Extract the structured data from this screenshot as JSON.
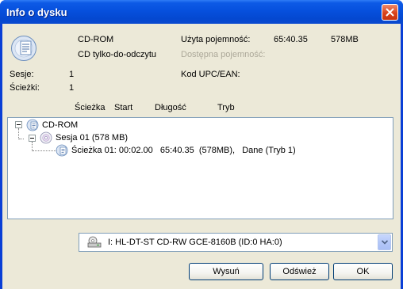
{
  "window": {
    "title": "Info o dysku"
  },
  "disc": {
    "type": "CD-ROM",
    "subtype": "CD tylko-do-odczytu",
    "used_label": "Użyta pojemność:",
    "used_time": "65:40.35",
    "used_size": "578MB",
    "available_label": "Dostępna pojemność:",
    "sessions_label": "Sesje:",
    "sessions_value": "1",
    "tracks_label": "Ścieżki:",
    "tracks_value": "1",
    "upc_label": "Kod UPC/EAN:"
  },
  "columns": [
    "Ścieżka",
    "Start",
    "Długość",
    "Tryb"
  ],
  "tree": {
    "root": "CD-ROM",
    "session": "Sesja 01 (578 MB)",
    "track": "Ścieżka 01: 00:02.00   65:40.35  (578MB),   Dane (Tryb 1)"
  },
  "drive": {
    "selected": "I: HL-DT-ST CD-RW GCE-8160B  (ID:0  HA:0)"
  },
  "buttons": {
    "eject": "Wysuń",
    "refresh": "Odśwież",
    "ok": "OK"
  },
  "colors": {
    "titlebar": "#0650dd",
    "dialog_bg": "#ece9d8",
    "listbox_border": "#7f9db9",
    "close": "#d9431c"
  },
  "icons": {
    "close": "close-icon",
    "disc": "cd-disc-icon",
    "drive": "drive-icon",
    "dropdown": "chevron-down-icon"
  }
}
